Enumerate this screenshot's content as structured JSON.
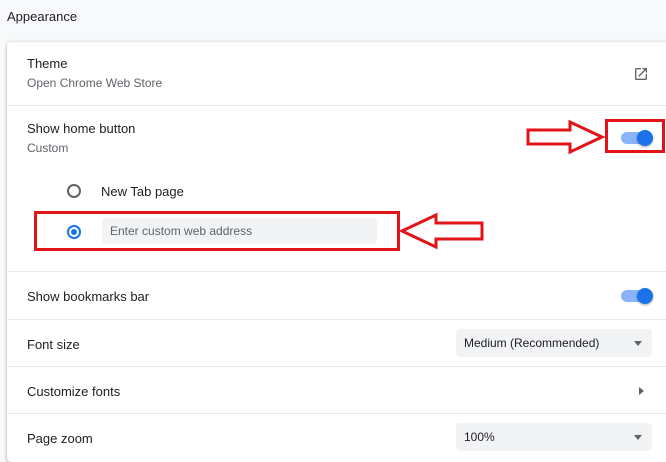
{
  "section_title": "Appearance",
  "theme": {
    "label": "Theme",
    "sublabel": "Open Chrome Web Store",
    "icon": "open-in-new-icon"
  },
  "home_button": {
    "label": "Show home button",
    "sublabel": "Custom",
    "enabled": true,
    "options": [
      {
        "label": "New Tab page",
        "selected": false
      },
      {
        "placeholder": "Enter custom web address",
        "value": "",
        "selected": true
      }
    ]
  },
  "bookmarks_bar": {
    "label": "Show bookmarks bar",
    "enabled": true
  },
  "font_size": {
    "label": "Font size",
    "value": "Medium (Recommended)"
  },
  "customize_fonts": {
    "label": "Customize fonts"
  },
  "page_zoom": {
    "label": "Page zoom",
    "value": "100%"
  },
  "colors": {
    "accent": "#1a73e8",
    "annotation": "#e2141a"
  }
}
